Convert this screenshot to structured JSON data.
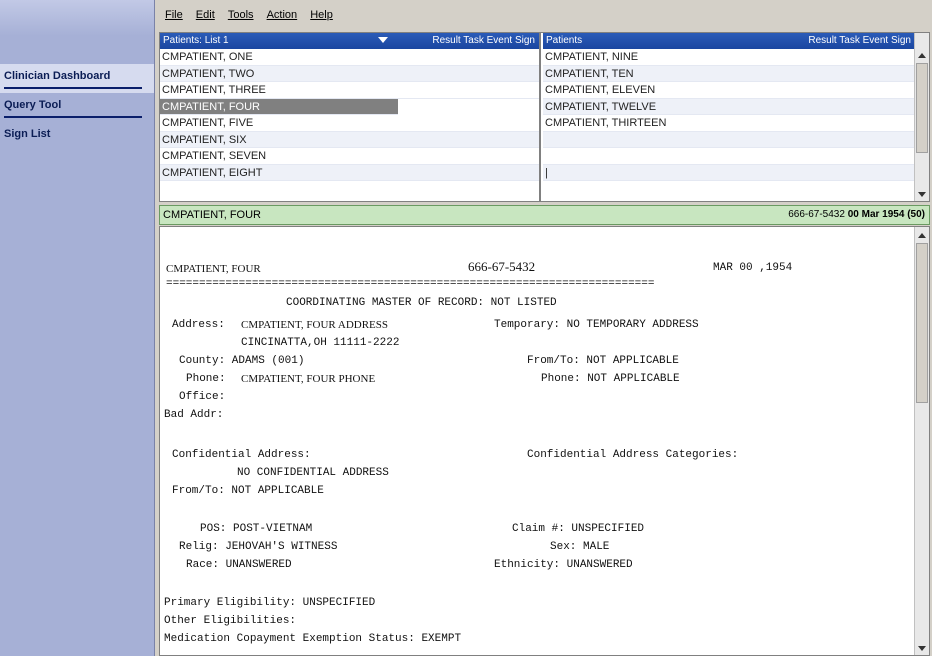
{
  "sidebar": {
    "items": [
      {
        "label": "Clinician Dashboard"
      },
      {
        "label": "Query Tool"
      },
      {
        "label": "Sign List"
      }
    ]
  },
  "menu": [
    "File",
    "Edit",
    "Tools",
    "Action",
    "Help"
  ],
  "left_list": {
    "title": "Patients: List 1",
    "columns": "Result Task Event Sign",
    "rows": [
      "CMPATIENT, ONE",
      "CMPATIENT, TWO",
      "CMPATIENT, THREE",
      "CMPATIENT, FOUR",
      "CMPATIENT, FIVE",
      "CMPATIENT, SIX",
      "CMPATIENT, SEVEN",
      "CMPATIENT, EIGHT"
    ],
    "selected": "CMPATIENT, FOUR"
  },
  "right_list": {
    "title": "Patients",
    "columns": "Result Task Event Sign",
    "rows": [
      "CMPATIENT, NINE",
      "CMPATIENT, TEN",
      "CMPATIENT, ELEVEN",
      "CMPATIENT, TWELVE",
      "CMPATIENT, THIRTEEN",
      "",
      "",
      "|"
    ]
  },
  "banner": {
    "name": "CMPATIENT, FOUR",
    "ssn": "666-67-5432",
    "dob": "00 Mar 1954 (50)"
  },
  "report": {
    "header_name": "CMPATIENT, FOUR",
    "header_ssn": "666-67-5432",
    "header_dob": "MAR 00 ,1954",
    "separator": "==========================================================================",
    "cmor": "COORDINATING MASTER OF RECORD: NOT LISTED",
    "address_label": "Address:",
    "address_value": "CMPATIENT, FOUR ADDRESS",
    "temporary": "Temporary: NO TEMPORARY ADDRESS",
    "city": "CINCINATTA,OH 11111-2222",
    "county": "County: ADAMS (001)",
    "from_to_1": "From/To: NOT APPLICABLE",
    "phone_label": "Phone:",
    "phone_value": "CMPATIENT, FOUR PHONE",
    "phone_2": "Phone: NOT APPLICABLE",
    "office": "Office:",
    "bad_addr": "Bad Addr:",
    "conf_address": "Confidential Address:",
    "conf_categories": "Confidential Address Categories:",
    "no_conf": "NO CONFIDENTIAL ADDRESS",
    "from_to_2": "From/To: NOT APPLICABLE",
    "pos": "POS: POST-VIETNAM",
    "claim": "Claim #: UNSPECIFIED",
    "relig": "Relig: JEHOVAH'S WITNESS",
    "sex": "Sex: MALE",
    "race": "Race: UNANSWERED",
    "ethnicity": "Ethnicity: UNANSWERED",
    "primary_elig": "Primary Eligibility: UNSPECIFIED",
    "other_elig": "Other Eligibilities:",
    "med_copay": "Medication Copayment Exemption Status: EXEMPT"
  }
}
